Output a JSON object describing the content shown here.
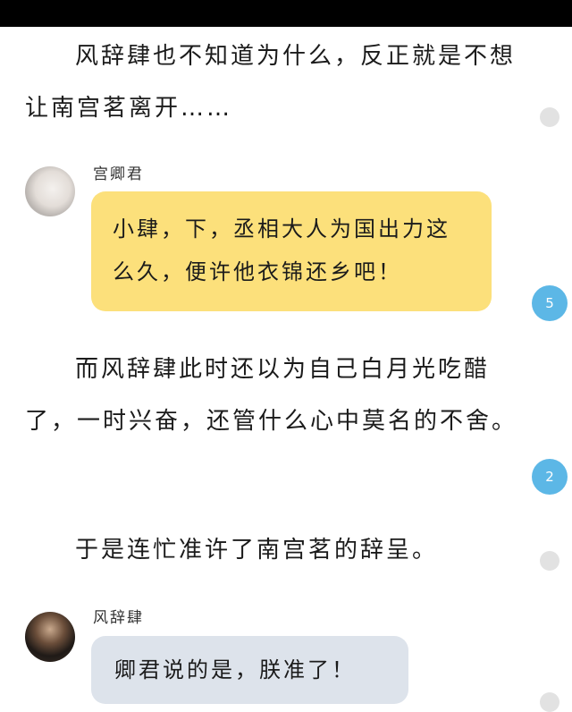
{
  "paragraphs": {
    "p1": "风辞肆也不知道为什么，反正就是不想让南宫茗离开……",
    "p2": "而风辞肆此时还以为自己白月光吃醋了，一时兴奋，还管什么心中莫名的不舍。",
    "p3": "于是连忙准许了南宫茗的辞呈。"
  },
  "messages": [
    {
      "speaker": "宫卿君",
      "text": "小肆，下，丞相大人为国出力这么久，便许他衣锦还乡吧！",
      "avatar_icon": "portrait-avatar-icon",
      "bubble_color": "#fce07b"
    },
    {
      "speaker": "风辞肆",
      "text": "卿君说的是，朕准了！",
      "avatar_icon": "portrait-avatar-icon",
      "bubble_color": "#dde3eb"
    }
  ],
  "comment_badges": [
    "5",
    "2"
  ],
  "colors": {
    "status_bar": "#000000",
    "badge": "#5cb7e6",
    "inactive_dot": "#e2e2e2"
  }
}
